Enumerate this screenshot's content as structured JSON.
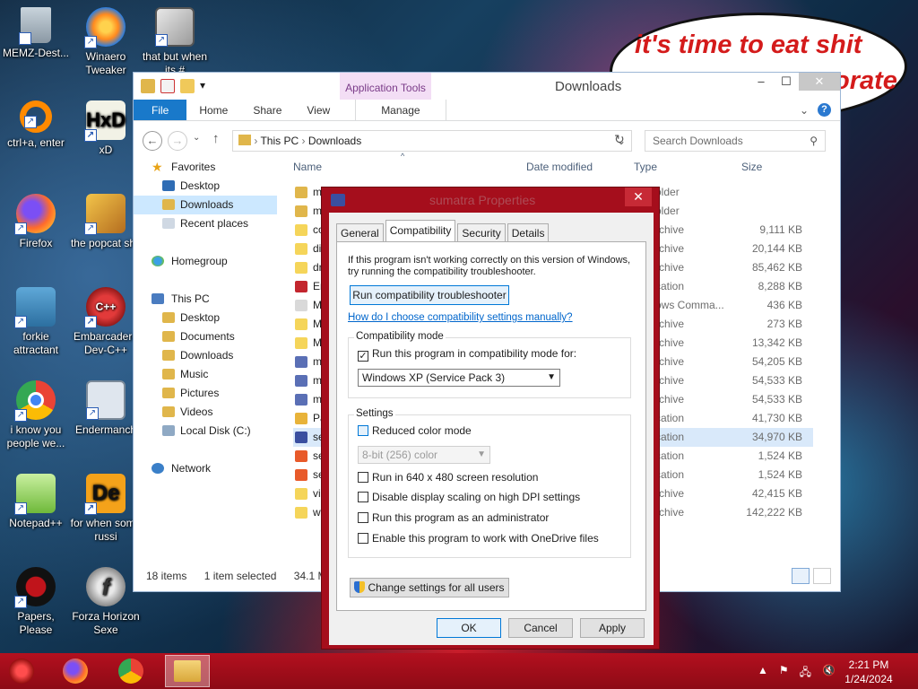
{
  "desktop": {
    "bubble_text": "it's time to eat shit",
    "bubble_text_2": "orate",
    "icons": [
      {
        "label": "MEMZ-Dest...",
        "icon": "recycle-bin-icon"
      },
      {
        "label": "Winaero Tweaker",
        "icon": "winaero-icon"
      },
      {
        "label": "that but when its #",
        "icon": "stack-icon"
      },
      {
        "label": "ctrl+a, enter",
        "icon": "ring-icon"
      },
      {
        "label": "xD",
        "icon": "hxd-icon"
      },
      {
        "label": "Firefox",
        "icon": "firefox-icon"
      },
      {
        "label": "the popcat shit",
        "icon": "popcat-icon"
      },
      {
        "label": "forkie attractant",
        "icon": "forkie-icon"
      },
      {
        "label": "Embarcadero Dev-C++",
        "icon": "devcpp-icon"
      },
      {
        "label": "i know you people we...",
        "icon": "chrome-icon"
      },
      {
        "label": "Endermanch",
        "icon": "endermanch-icon"
      },
      {
        "label": "Notepad++",
        "icon": "notepadpp-icon"
      },
      {
        "label": "for when some russi",
        "icon": "de-icon"
      },
      {
        "label": "Papers, Please",
        "icon": "papers-icon"
      },
      {
        "label": "Forza Horizon Sexe",
        "icon": "flash-icon"
      }
    ]
  },
  "explorer": {
    "title": "Downloads",
    "app_tools": "Application Tools",
    "tabs": {
      "file": "File",
      "home": "Home",
      "share": "Share",
      "view": "View",
      "manage": "Manage"
    },
    "address": {
      "this_pc": "This PC",
      "folder": "Downloads"
    },
    "search_placeholder": "Search Downloads",
    "nav": {
      "favorites": "Favorites",
      "desktop": "Desktop",
      "downloads": "Downloads",
      "recent": "Recent places",
      "homegroup": "Homegroup",
      "thispc": "This PC",
      "pc_desktop": "Desktop",
      "documents": "Documents",
      "pc_downloads": "Downloads",
      "music": "Music",
      "pictures": "Pictures",
      "videos": "Videos",
      "localdisk": "Local Disk (C:)",
      "network": "Network"
    },
    "columns": {
      "name": "Name",
      "date": "Date modified",
      "type": "Type",
      "size": "Size"
    },
    "files": [
      {
        "name": "m",
        "type": "older",
        "size": ""
      },
      {
        "name": "m",
        "type": "older",
        "size": ""
      },
      {
        "name": "co",
        "type": "rchive",
        "size": "9,111 KB"
      },
      {
        "name": "di",
        "type": "rchive",
        "size": "20,144 KB"
      },
      {
        "name": "dr",
        "type": "rchive",
        "size": "85,462 KB"
      },
      {
        "name": "En",
        "type": "cation",
        "size": "8,288 KB"
      },
      {
        "name": "M",
        "type": "ows Comma...",
        "size": "436 KB"
      },
      {
        "name": "M",
        "type": "rchive",
        "size": "273 KB"
      },
      {
        "name": "M",
        "type": "rchive",
        "size": "13,342 KB"
      },
      {
        "name": "m",
        "type": "rchive",
        "size": "54,205 KB"
      },
      {
        "name": "m",
        "type": "rchive",
        "size": "54,533 KB"
      },
      {
        "name": "m",
        "type": "rchive",
        "size": "54,533 KB"
      },
      {
        "name": "Pa",
        "type": "cation",
        "size": "41,730 KB"
      },
      {
        "name": "se",
        "type": "cation",
        "size": "34,970 KB"
      },
      {
        "name": "se",
        "type": "cation",
        "size": "1,524 KB"
      },
      {
        "name": "se",
        "type": "cation",
        "size": "1,524 KB"
      },
      {
        "name": "vi",
        "type": "rchive",
        "size": "42,415 KB"
      },
      {
        "name": "wi",
        "type": "rchive",
        "size": "142,222 KB"
      }
    ],
    "status": {
      "items": "18 items",
      "selected": "1 item selected",
      "size": "34.1 MB"
    }
  },
  "properties": {
    "title": "sumatra Properties",
    "close": "✕",
    "tabs": {
      "general": "General",
      "compatibility": "Compatibility",
      "security": "Security",
      "details": "Details"
    },
    "intro": "If this program isn't working correctly on this version of Windows, try running the compatibility troubleshooter.",
    "troubleshooter_button": "Run compatibility troubleshooter",
    "help_link": "How do I choose compatibility settings manually?",
    "compat_mode": {
      "group_title": "Compatibility mode",
      "run_in_mode_label": "Run this program in compatibility mode for:",
      "run_in_mode_checked": true,
      "selected_os": "Windows XP (Service Pack 3)"
    },
    "settings": {
      "group_title": "Settings",
      "reduced_color": "Reduced color mode",
      "color_option": "8-bit (256) color",
      "res_640": "Run in 640 x 480 screen resolution",
      "dpi": "Disable display scaling on high DPI settings",
      "admin": "Run this program as an administrator",
      "onedrive": "Enable this program to work with OneDrive files"
    },
    "change_all_button": "Change settings for all users",
    "ok": "OK",
    "cancel": "Cancel",
    "apply": "Apply"
  },
  "taskbar": {
    "time": "2:21 PM",
    "date": "1/24/2024"
  },
  "colors": {
    "accent": "#1979ca",
    "dialog_frame": "#a50e1c",
    "taskbar": "#b3101f",
    "bubble_text": "#d41b1b"
  }
}
